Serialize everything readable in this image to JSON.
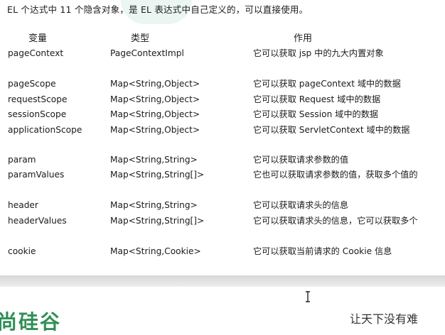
{
  "intro": "EL 个达式中 11 个隐含对象，是 EL 表达式中自己定义的，可以直接使用。",
  "headers": {
    "variable": "变量",
    "type": "类型",
    "usage": "作用"
  },
  "rows": [
    {
      "name": "pageContext",
      "type": "PageContextImpl",
      "desc": "它可以获取 jsp 中的九大内置对象"
    },
    {
      "name": "pageScope",
      "type": "Map<String,Object>",
      "desc": "它可以获取 pageContext 域中的数据"
    },
    {
      "name": "requestScope",
      "type": "Map<String,Object>",
      "desc": "它可以获取 Request 域中的数据"
    },
    {
      "name": "sessionScope",
      "type": "Map<String,Object>",
      "desc": "它可以获取 Session 域中的数据"
    },
    {
      "name": "applicationScope",
      "type": "Map<String,Object>",
      "desc": "它可以获取 ServletContext 域中的数据"
    },
    {
      "name": "param",
      "type": "Map<String,String>",
      "desc": "它可以获取请求参数的值"
    },
    {
      "name": "paramValues",
      "type": "Map<String,String[]>",
      "desc": "它也可以获取请求参数的值，获取多个值的"
    },
    {
      "name": "header",
      "type": "Map<String,String>",
      "desc": "它可以获取请求头的信息"
    },
    {
      "name": "headerValues",
      "type": "Map<String,String[]>",
      "desc": "它可以获取请求头的信息，它可以获取多个"
    },
    {
      "name": "cookie",
      "type": "Map<String,Cookie>",
      "desc": "它可以获取当前请求的 Cookie 信息"
    }
  ],
  "bottom": {
    "logo_text": "尚硅谷",
    "footer_text": "让天下没有难"
  }
}
